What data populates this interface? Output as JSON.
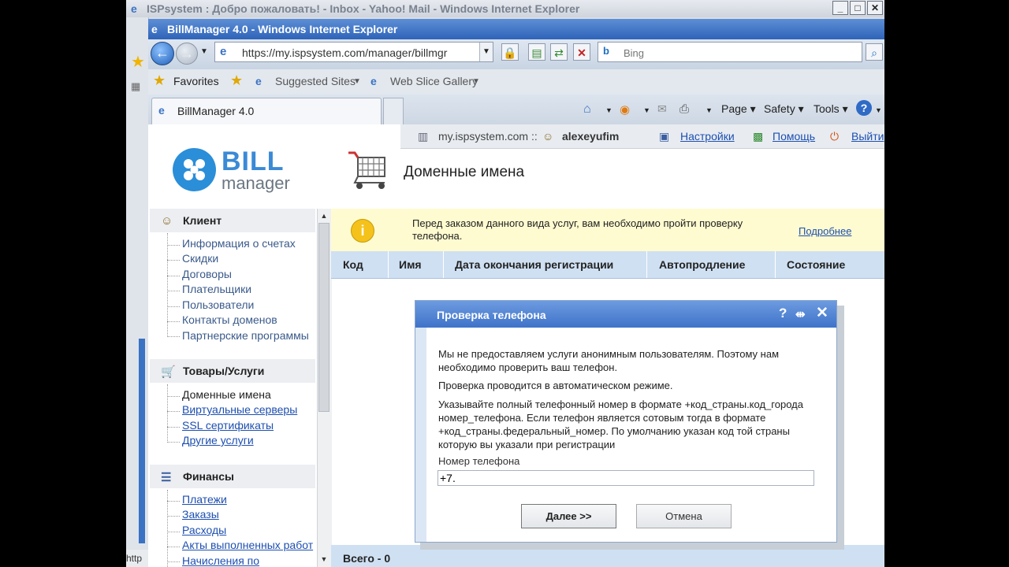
{
  "background_window": {
    "title": "ISPsystem : Добро пожаловать! - Inbox - Yahoo! Mail - Windows Internet Explorer",
    "status_text": "http"
  },
  "browser": {
    "title": "BillManager 4.0 - Windows Internet Explorer",
    "url": "https://my.ispsystem.com/manager/billmgr",
    "search_placeholder": "Bing",
    "favorites": [
      "Favorites",
      "Suggested Sites",
      "Web Slice Gallery"
    ],
    "tab_label": "BillManager 4.0",
    "commands": [
      "Page",
      "Safety",
      "Tools"
    ]
  },
  "userbar": {
    "host": "my.ispsystem.com ::",
    "user": "alexeyufim",
    "settings": "Настройки",
    "help": "Помощь",
    "logout": "Выйти"
  },
  "logo": {
    "line1": "BILL",
    "line2": "manager"
  },
  "page_title": "Доменные имена",
  "sidebar": {
    "sections": [
      {
        "title": "Клиент",
        "items": [
          "Информация о счетах",
          "Скидки",
          "Договоры",
          "Плательщики",
          "Пользователи",
          "Контакты доменов",
          "Партнерские программы"
        ]
      },
      {
        "title": "Товары/Услуги",
        "items": [
          "Доменные имена",
          "Виртуальные серверы",
          "SSL сертификаты",
          "Другие услуги"
        ]
      },
      {
        "title": "Финансы",
        "items": [
          "Платежи",
          "Заказы",
          "Расходы",
          "Акты выполненных работ",
          "Начисления по"
        ]
      }
    ]
  },
  "notice": {
    "text": "Перед заказом данного вида услуг, вам необходимо пройти проверку телефона.",
    "more": "Подробнее"
  },
  "table": {
    "columns": [
      "Код",
      "Имя",
      "Дата окончания регистрации",
      "Автопродление",
      "Состояние"
    ],
    "total": "Всего - 0"
  },
  "dialog": {
    "title": "Проверка телефона",
    "p1": "Мы не предоставляем услуги анонимным пользователям. Поэтому нам необходимо проверить ваш телефон.",
    "p2": "Проверка проводится в автоматическом режиме.",
    "p3": "Указывайте полный телефонный номер в формате +код_страны.код_города номер_телефона. Если телефон является сотовым тогда в формате +код_страны.федеральный_номер. По умолчанию указан код той страны которую вы указали при регистрации",
    "phone_label": "Номер телефона",
    "phone_value": "+7.",
    "next": "Далее >>",
    "cancel": "Отмена"
  }
}
